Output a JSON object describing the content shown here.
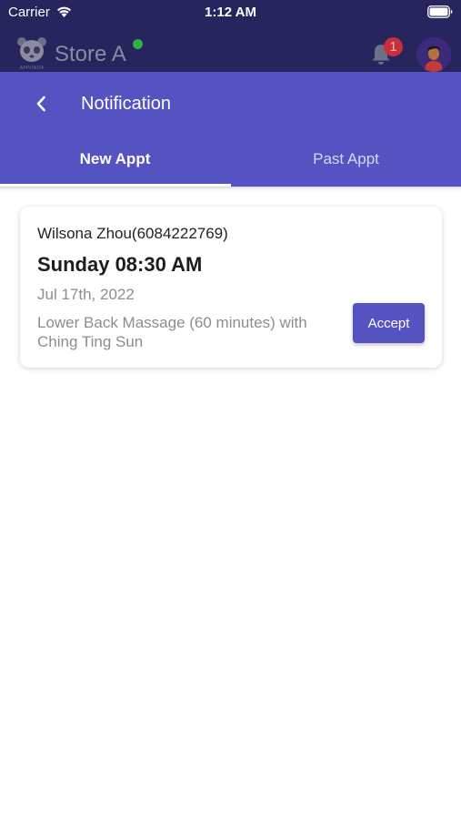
{
  "status_bar": {
    "carrier": "Carrier",
    "time": "1:12 AM"
  },
  "app_header": {
    "store_name": "Store A",
    "logo_text": "APPONDA",
    "notification_count": "1"
  },
  "notification_sheet": {
    "title": "Notification",
    "tabs": [
      {
        "label": "New Appt",
        "active": true
      },
      {
        "label": "Past Appt",
        "active": false
      }
    ]
  },
  "appointments": [
    {
      "client": "Wilsona Zhou(6084222769)",
      "time": "Sunday 08:30 AM",
      "date": "Jul 17th, 2022",
      "service": "Lower Back Massage (60 minutes) with Ching Ting Sun",
      "action_label": "Accept"
    }
  ],
  "colors": {
    "primary": "#5553c2",
    "app_bar": "#27255e",
    "badge": "#c72f3b",
    "online": "#2fb04a"
  },
  "icons": {
    "wifi": "wifi-icon",
    "battery": "battery-icon",
    "logo": "panda-logo-icon",
    "bell": "bell-icon",
    "back": "chevron-left-icon"
  }
}
